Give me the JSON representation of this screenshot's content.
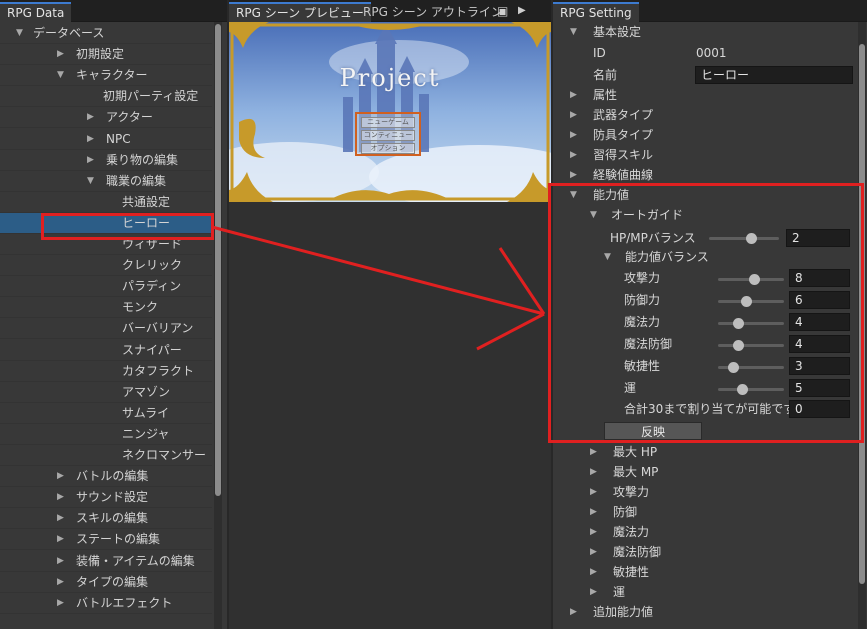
{
  "left_panel": {
    "tab": "RPG Data",
    "tree": [
      {
        "label": "データベース",
        "tri": "▼",
        "depth": 0
      },
      {
        "label": "初期設定",
        "tri": "▶",
        "depth": 1
      },
      {
        "label": "キャラクター",
        "tri": "▼",
        "depth": 1
      },
      {
        "label": "初期パーティ設定",
        "tri": "",
        "depth": 2
      },
      {
        "label": "アクター",
        "tri": "▶",
        "depth": 2
      },
      {
        "label": "NPC",
        "tri": "▶",
        "depth": 2
      },
      {
        "label": "乗り物の編集",
        "tri": "▶",
        "depth": 2
      },
      {
        "label": "職業の編集",
        "tri": "▼",
        "depth": 2
      },
      {
        "label": "共通設定",
        "tri": "",
        "depth": 3
      },
      {
        "label": "ヒーロー",
        "tri": "",
        "depth": 3,
        "selected": true
      },
      {
        "label": "ウィザード",
        "tri": "",
        "depth": 3
      },
      {
        "label": "クレリック",
        "tri": "",
        "depth": 3
      },
      {
        "label": "パラディン",
        "tri": "",
        "depth": 3
      },
      {
        "label": "モンク",
        "tri": "",
        "depth": 3
      },
      {
        "label": "バーバリアン",
        "tri": "",
        "depth": 3
      },
      {
        "label": "スナイパー",
        "tri": "",
        "depth": 3
      },
      {
        "label": "カタフラクト",
        "tri": "",
        "depth": 3
      },
      {
        "label": "アマゾン",
        "tri": "",
        "depth": 3
      },
      {
        "label": "サムライ",
        "tri": "",
        "depth": 3
      },
      {
        "label": "ニンジャ",
        "tri": "",
        "depth": 3
      },
      {
        "label": "ネクロマンサー",
        "tri": "",
        "depth": 3
      },
      {
        "label": "バトルの編集",
        "tri": "▶",
        "depth": 1
      },
      {
        "label": "サウンド設定",
        "tri": "▶",
        "depth": 1
      },
      {
        "label": "スキルの編集",
        "tri": "▶",
        "depth": 1
      },
      {
        "label": "ステートの編集",
        "tri": "▶",
        "depth": 1
      },
      {
        "label": "装備・アイテムの編集",
        "tri": "▶",
        "depth": 1
      },
      {
        "label": "タイプの編集",
        "tri": "▶",
        "depth": 1
      },
      {
        "label": "バトルエフェクト",
        "tri": "▶",
        "depth": 1
      }
    ]
  },
  "middle_panel": {
    "tabs": [
      "RPG シーン プレビュー",
      "RPG シーン アウトライン"
    ],
    "preview": {
      "title": "Project",
      "menu": [
        "ニューゲーム",
        "コンティニュー",
        "オプション"
      ]
    }
  },
  "right_panel": {
    "tab": "RPG Setting",
    "basic_label": "基本設定",
    "id_label": "ID",
    "id_value": "0001",
    "name_label": "名前",
    "name_value": "ヒーロー",
    "sections_top": [
      "属性",
      "武器タイプ",
      "防具タイプ",
      "習得スキル",
      "経験値曲線"
    ],
    "ability_label": "能力値",
    "autoguide_label": "オートガイド",
    "hpmp_label": "HP/MPバランス",
    "hpmp_value": "2",
    "hpmp_level": 0.6,
    "stat_balance_label": "能力値バランス",
    "stats": [
      {
        "label": "攻撃力",
        "value": "8",
        "level": 0.55
      },
      {
        "label": "防御力",
        "value": "6",
        "level": 0.43
      },
      {
        "label": "魔法力",
        "value": "4",
        "level": 0.3
      },
      {
        "label": "魔法防御",
        "value": "4",
        "level": 0.3
      },
      {
        "label": "敏捷性",
        "value": "3",
        "level": 0.22
      },
      {
        "label": "運",
        "value": "5",
        "level": 0.37
      }
    ],
    "total_label": "合計30まで割り当てが可能です。",
    "total_value": "0",
    "apply_label": "反映",
    "sections_bottom": [
      "最大 HP",
      "最大 MP",
      "攻撃力",
      "防御",
      "魔法力",
      "魔法防御",
      "敏捷性",
      "運"
    ],
    "extra_label": "追加能力値"
  },
  "colors": {
    "highlight": "#e02020",
    "selection": "#2c5d87",
    "tab_accent": "#3d7bd0"
  }
}
